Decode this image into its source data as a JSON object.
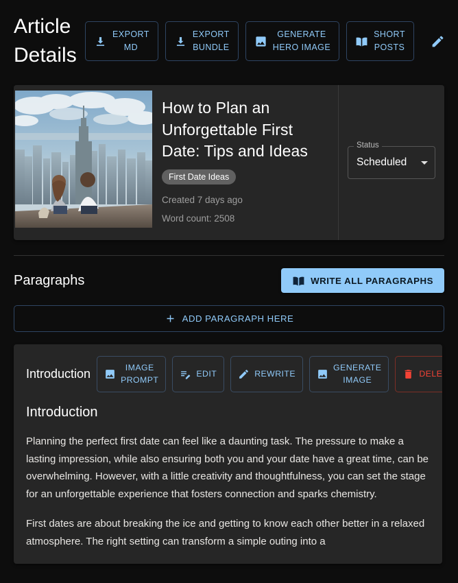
{
  "header": {
    "title": "Article Details",
    "actions": [
      {
        "label_line1": "EXPORT",
        "label_line2": "MD",
        "icon": "download-icon"
      },
      {
        "label_line1": "EXPORT",
        "label_line2": "BUNDLE",
        "icon": "download-icon"
      },
      {
        "label_line1": "GENERATE",
        "label_line2": "HERO IMAGE",
        "icon": "image-icon"
      },
      {
        "label_line1": "SHORT",
        "label_line2": "POSTS",
        "icon": "menu-book-icon"
      }
    ],
    "edit_icon": "pencil-icon"
  },
  "article": {
    "title": "How to Plan an Unforgettable First Date: Tips and Ideas",
    "category_chip": "First Date Ideas",
    "created": "Created 7 days ago",
    "word_count": "Word count: 2508",
    "status": {
      "label": "Status",
      "value": "Scheduled"
    },
    "hero_alt": "couple sitting on ledge overlooking city skyline"
  },
  "paragraphs_section": {
    "heading": "Paragraphs",
    "write_all_label": "WRITE ALL PARAGRAPHS",
    "write_all_icon": "menu-book-icon",
    "add_paragraph_label": "ADD PARAGRAPH HERE",
    "add_icon": "plus-icon"
  },
  "paragraph_card": {
    "name": "Introduction",
    "toolbar": [
      {
        "label_line1": "IMAGE",
        "label_line2": "PROMPT",
        "icon": "image-icon",
        "danger": false
      },
      {
        "label_line1": "EDIT",
        "label_line2": "",
        "icon": "edit-note-icon",
        "danger": false
      },
      {
        "label_line1": "REWRITE",
        "label_line2": "",
        "icon": "pencil-icon",
        "danger": false
      },
      {
        "label_line1": "GENERATE",
        "label_line2": "IMAGE",
        "icon": "image-icon",
        "danger": false
      },
      {
        "label_line1": "DELETE",
        "label_line2": "",
        "icon": "trash-icon",
        "danger": true
      }
    ],
    "body_heading": "Introduction",
    "body_paragraphs": [
      "Planning the perfect first date can feel like a daunting task. The pressure to make a lasting impression, while also ensuring both you and your date have a great time, can be overwhelming. However, with a little creativity and thoughtfulness, you can set the stage for an unforgettable experience that fosters connection and sparks chemistry.",
      "First dates are about breaking the ice and getting to know each other better in a relaxed atmosphere. The right setting can transform a simple outing into a"
    ]
  },
  "colors": {
    "page_bg": "#0d0d0d",
    "card_bg": "#262626",
    "accent_blue": "#90caf9",
    "danger_red": "#f44336",
    "chip_bg": "#616161",
    "muted_text": "#9e9e9e"
  }
}
